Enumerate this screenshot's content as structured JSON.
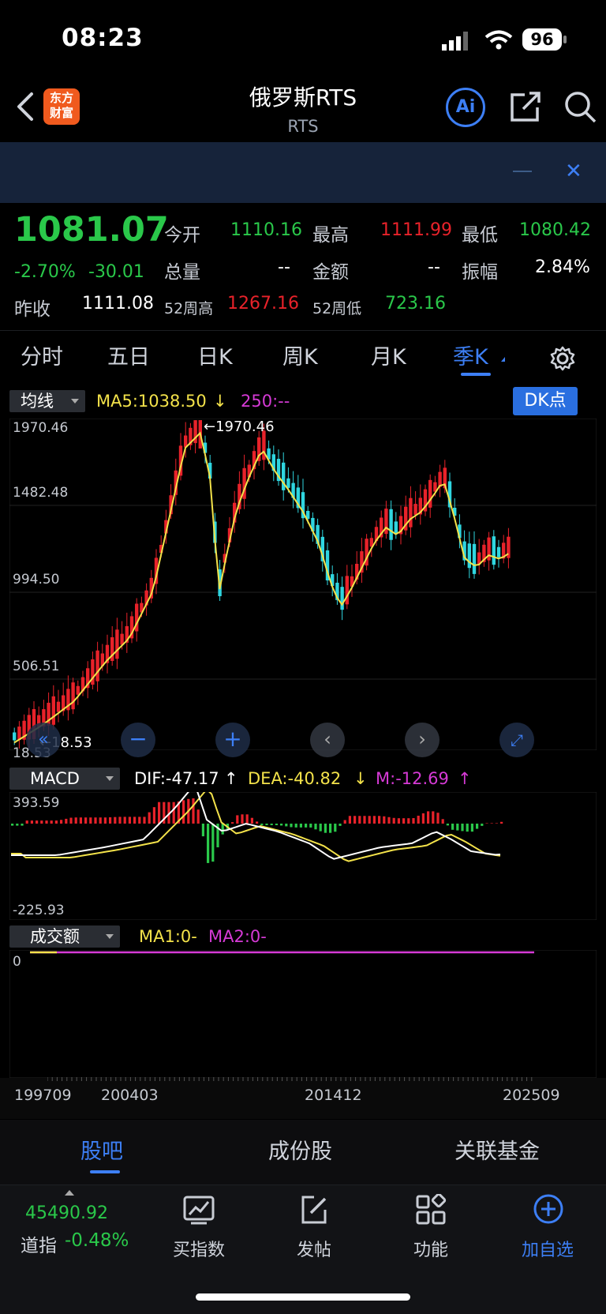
{
  "status_bar": {
    "time": "08:23",
    "battery": "96"
  },
  "header": {
    "app_badge_line1": "东方",
    "app_badge_line2": "财富",
    "title": "俄罗斯RTS",
    "subtitle": "RTS",
    "ai_label": "Ai"
  },
  "banner": {
    "close": "✕"
  },
  "quote": {
    "price": "1081.07",
    "change_pct": "-2.70%",
    "change": "-30.01",
    "prev_close_label": "昨收",
    "prev_close": "1111.08",
    "open_label": "今开",
    "open": "1110.16",
    "high_label": "最高",
    "high": "1111.99",
    "low_label": "最低",
    "low": "1080.42",
    "volume_label": "总量",
    "volume": "--",
    "amount_label": "金额",
    "amount": "--",
    "amplitude_label": "振幅",
    "amplitude": "2.84%",
    "week52_high_label": "52周高",
    "week52_high": "1267.16",
    "week52_low_label": "52周低",
    "week52_low": "723.16"
  },
  "period_tabs": [
    "分时",
    "五日",
    "日K",
    "周K",
    "月K",
    "季K"
  ],
  "active_period": "季K",
  "main_chart": {
    "selector": "均线",
    "ma5": "MA5:1038.50",
    "ma5_arrow": "↓",
    "ma250": "250:--",
    "dk_button": "DK点",
    "y_ticks": [
      "1970.46",
      "1482.48",
      "994.50",
      "506.51",
      "18.53"
    ],
    "max_label": "←1970.46",
    "min_label": "←18.53"
  },
  "macd": {
    "selector": "MACD",
    "dif": "DIF:-47.17",
    "dif_arrow": "↑",
    "dea": "DEA:-40.82",
    "dea_arrow": "↓",
    "m": "M:-12.69",
    "m_arrow": "↑",
    "y_top": "393.59",
    "y_bottom": "-225.93"
  },
  "volume": {
    "selector": "成交额",
    "ma1": "MA1:0-",
    "ma2": "MA2:0-",
    "y_tick": "0"
  },
  "x_axis": [
    "199709",
    "200403",
    "201412",
    "202509"
  ],
  "bottom_tabs": [
    "股吧",
    "成份股",
    "关联基金"
  ],
  "bottom_active": "股吧",
  "ticker": {
    "value": "45490.92",
    "name": "道指",
    "change": "-0.48%"
  },
  "toolbar": [
    "买指数",
    "发帖",
    "功能",
    "加自选"
  ],
  "colors": {
    "up": "#e8222a",
    "down": "#2ac84a",
    "accent": "#3d7ff5",
    "candle_down": "#2fd6e0",
    "ma5": "#f3e24a",
    "ma_purple": "#d63ad6"
  }
}
